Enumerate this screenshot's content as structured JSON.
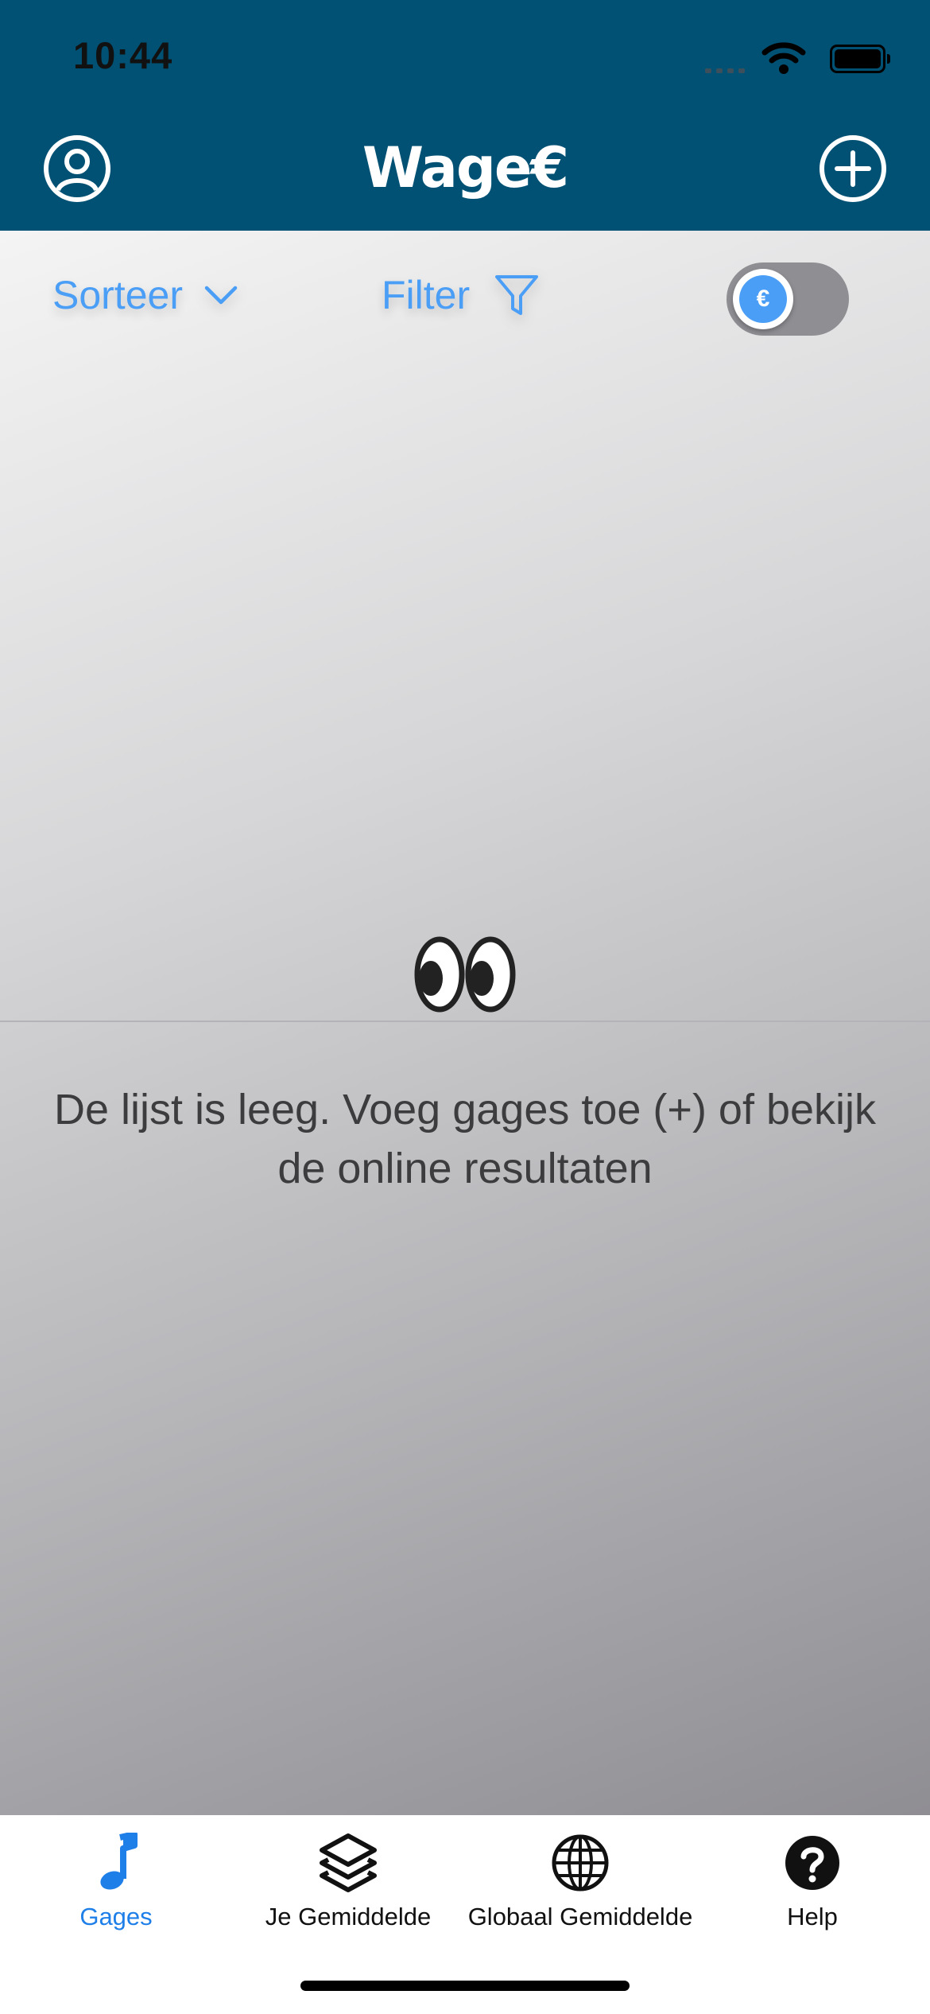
{
  "status_bar": {
    "time": "10:44"
  },
  "header": {
    "logo": "Wage€",
    "profile_icon": "person-circle-icon",
    "add_icon": "plus-circle-icon"
  },
  "toolbar": {
    "sort_label": "Sorteer",
    "filter_label": "Filter",
    "currency_toggle_symbol": "€",
    "currency_toggle_on": false
  },
  "empty_state": {
    "emoji": "eyes-emoji",
    "message": "De lijst is leeg. Voeg gages toe (+) of bekijk de online resultaten"
  },
  "tabs": [
    {
      "label": "Gages",
      "icon": "music-note-icon",
      "active": true
    },
    {
      "label": "Je Gemiddelde",
      "icon": "layers-icon",
      "active": false
    },
    {
      "label": "Globaal Gemiddelde",
      "icon": "globe-icon",
      "active": false
    },
    {
      "label": "Help",
      "icon": "question-circle-icon",
      "active": false
    }
  ],
  "colors": {
    "header": "#005173",
    "accent": "#4b9ef6",
    "tab_active": "#1f7fe8"
  }
}
